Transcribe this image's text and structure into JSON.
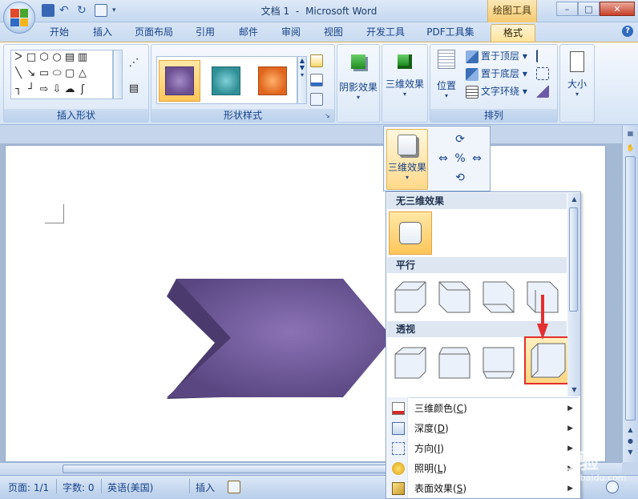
{
  "window": {
    "title_doc": "文档 1",
    "title_sep": "-",
    "title_app": "Microsoft Word",
    "context_tool": "绘图工具",
    "minimize": "–",
    "maximize": "□",
    "close": "✕"
  },
  "tabs": [
    {
      "label": "开始"
    },
    {
      "label": "插入"
    },
    {
      "label": "页面布局"
    },
    {
      "label": "引用"
    },
    {
      "label": "邮件"
    },
    {
      "label": "审阅"
    },
    {
      "label": "视图"
    },
    {
      "label": "开发工具"
    },
    {
      "label": "PDF工具集"
    },
    {
      "label": "格式",
      "active": true
    }
  ],
  "help": "?",
  "ribbon": {
    "groups": {
      "insert_shapes": "插入形状",
      "shape_styles": "形状样式",
      "arrange": "排列"
    },
    "shadow_effects": "阴影效果",
    "three_d_effects": "三维效果",
    "position": "位置",
    "bring_to_front": "置于顶层",
    "send_to_back": "置于底层",
    "text_wrap": "文字环绕",
    "size": "大小",
    "style_colors": [
      "#6b4f91",
      "#2f8f96",
      "#e0661d"
    ]
  },
  "dropdown_3d": {
    "button_label": "三维效果",
    "sections": {
      "no_3d": "无三维效果",
      "parallel": "平行",
      "perspective": "透视"
    },
    "menu_items": [
      {
        "label": "三维颜色(",
        "key": "C",
        "suffix": ")"
      },
      {
        "label": "深度(",
        "key": "D",
        "suffix": ")"
      },
      {
        "label": "方向(",
        "key": "I",
        "suffix": ")"
      },
      {
        "label": "照明(",
        "key": "L",
        "suffix": ")"
      },
      {
        "label": "表面效果(",
        "key": "S",
        "suffix": ")"
      }
    ]
  },
  "shape_color": "#6b5694",
  "status": {
    "page": "页面: 1/1",
    "words": "字数: 0",
    "lang": "英语(美国)",
    "mode": "插入"
  },
  "watermark": {
    "brand": "Baidu经验",
    "url": "jingyan.baidu.com"
  }
}
